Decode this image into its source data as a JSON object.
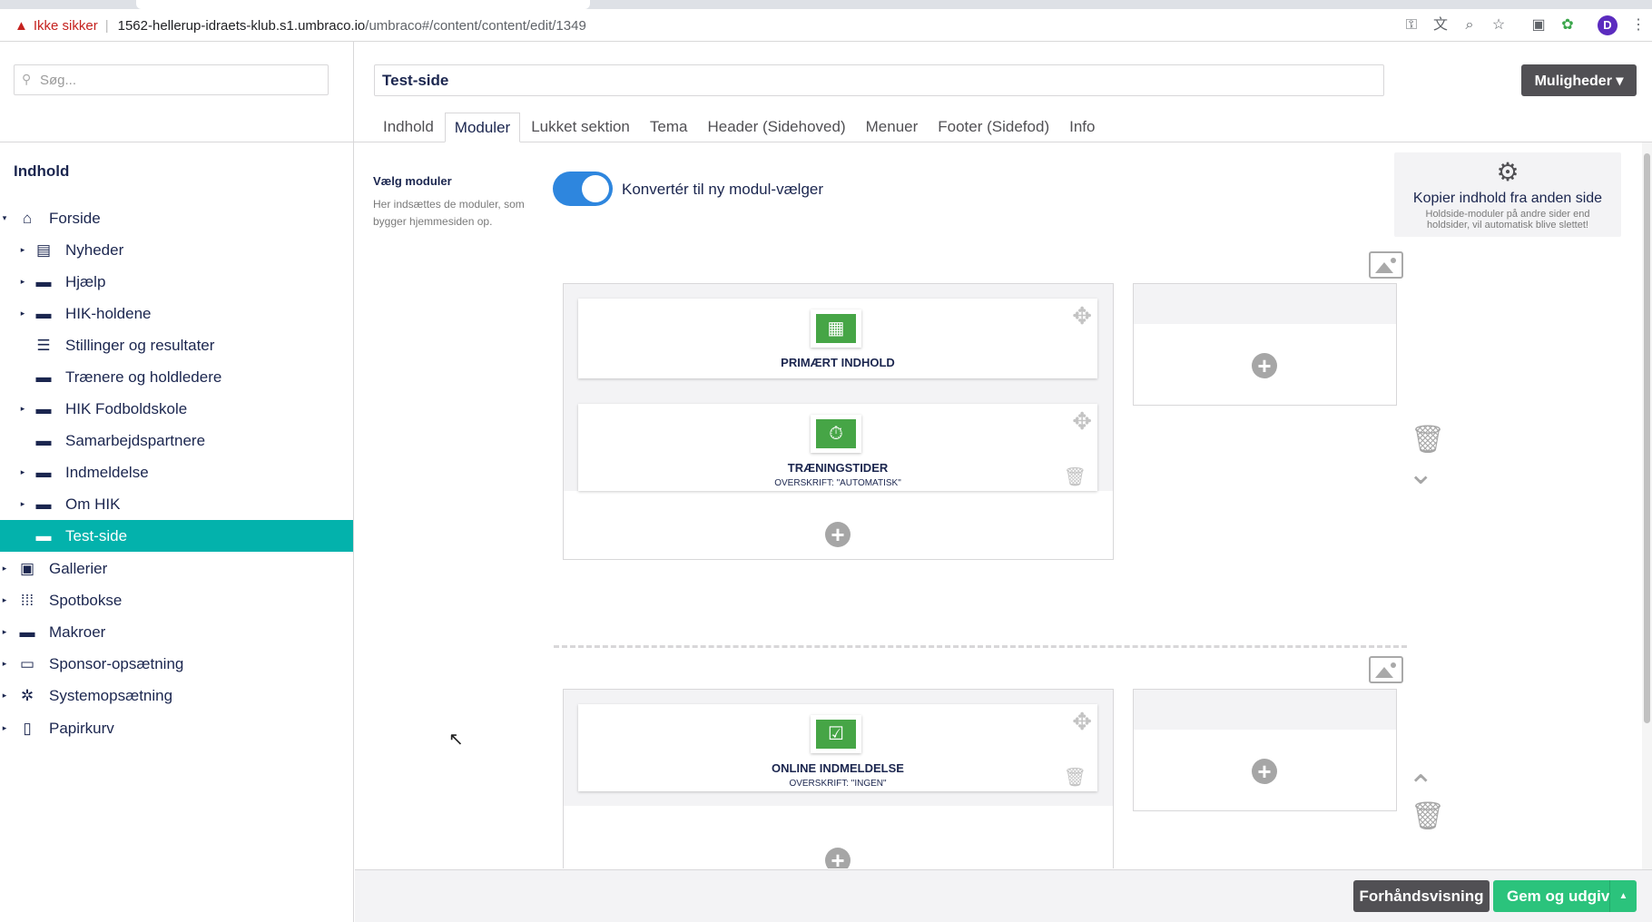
{
  "browser": {
    "security_warning": "Ikke sikker",
    "url_host": "1562-hellerup-idraets-klub.s1.umbraco.io",
    "url_path": "/umbraco#/content/content/edit/1349",
    "profile_initial": "D"
  },
  "sidebar": {
    "search_placeholder": "Søg...",
    "section_title": "Indhold",
    "tree": [
      {
        "label": "Forside",
        "icon": "home-icon",
        "glyph": "⌂",
        "expanded": true
      },
      {
        "label": "Nyheder",
        "icon": "newspaper-icon",
        "glyph": "▤",
        "has_children": true
      },
      {
        "label": "Hjælp",
        "icon": "folder-icon",
        "glyph": "▬",
        "has_children": true
      },
      {
        "label": "HIK-holdene",
        "icon": "folder-icon",
        "glyph": "▬",
        "has_children": true
      },
      {
        "label": "Stillinger og resultater",
        "icon": "list-icon",
        "glyph": "☰",
        "has_children": false
      },
      {
        "label": "Trænere og holdledere",
        "icon": "folder-icon",
        "glyph": "▬",
        "has_children": false
      },
      {
        "label": "HIK Fodboldskole",
        "icon": "folder-icon",
        "glyph": "▬",
        "has_children": true
      },
      {
        "label": "Samarbejdspartnere",
        "icon": "folder-icon",
        "glyph": "▬",
        "has_children": false
      },
      {
        "label": "Indmeldelse",
        "icon": "folder-icon",
        "glyph": "▬",
        "has_children": true
      },
      {
        "label": "Om HIK",
        "icon": "folder-icon",
        "glyph": "▬",
        "has_children": true
      },
      {
        "label": "Test-side",
        "icon": "folder-open-icon",
        "glyph": "▬",
        "active": true
      },
      {
        "label": "Gallerier",
        "icon": "gallery-icon",
        "glyph": "▣",
        "has_children": true
      },
      {
        "label": "Spotbokse",
        "icon": "grid-icon",
        "glyph": "⁞⁞⁞",
        "has_children": true
      },
      {
        "label": "Makroer",
        "icon": "folder-icon",
        "glyph": "▬",
        "has_children": true
      },
      {
        "label": "Sponsor-opsætning",
        "icon": "sponsor-icon",
        "glyph": "▭",
        "has_children": true
      },
      {
        "label": "Systemopsætning",
        "icon": "gear-icon",
        "glyph": "✲",
        "has_children": true
      },
      {
        "label": "Papirkurv",
        "icon": "trash-icon",
        "glyph": "▯",
        "has_children": true
      }
    ]
  },
  "editor": {
    "doc_name": "Test-side",
    "actions_label": "Muligheder ▾",
    "tabs": [
      "Indhold",
      "Moduler",
      "Lukket sektion",
      "Tema",
      "Header (Sidehoved)",
      "Menuer",
      "Footer (Sidefod)",
      "Info"
    ],
    "active_tab": "Moduler",
    "property_label": "Vælg moduler",
    "property_description": "Her indsættes de moduler, som bygger hjemmesiden op.",
    "toggle_label": "Konvertér til ny modul-vælger",
    "toggle_on": true,
    "copy_box": {
      "title": "Kopier indhold fra anden side",
      "subtitle": "Holdside-moduler på andre sider end holdsider, vil automatisk blive slettet!"
    },
    "modules": [
      {
        "name": "PRIMÆRT INDHOLD",
        "subtitle": "",
        "icon": "primary-content-icon"
      },
      {
        "name": "TRÆNINGSTIDER",
        "subtitle": "OVERSKRIFT: \"AUTOMATISK\"",
        "icon": "stopwatch-icon"
      },
      {
        "name": "ONLINE INDMELDELSE",
        "subtitle": "OVERSKRIFT: \"INGEN\"",
        "icon": "signup-form-icon"
      }
    ]
  },
  "footer": {
    "preview_label": "Forhåndsvisning",
    "publish_label": "Gem og udgiv"
  },
  "colors": {
    "active_tree": "#03b2ac",
    "toggle": "#2e86de",
    "publish": "#2bc37c",
    "secondary_button": "#515054",
    "module_icon": "#46a546"
  }
}
